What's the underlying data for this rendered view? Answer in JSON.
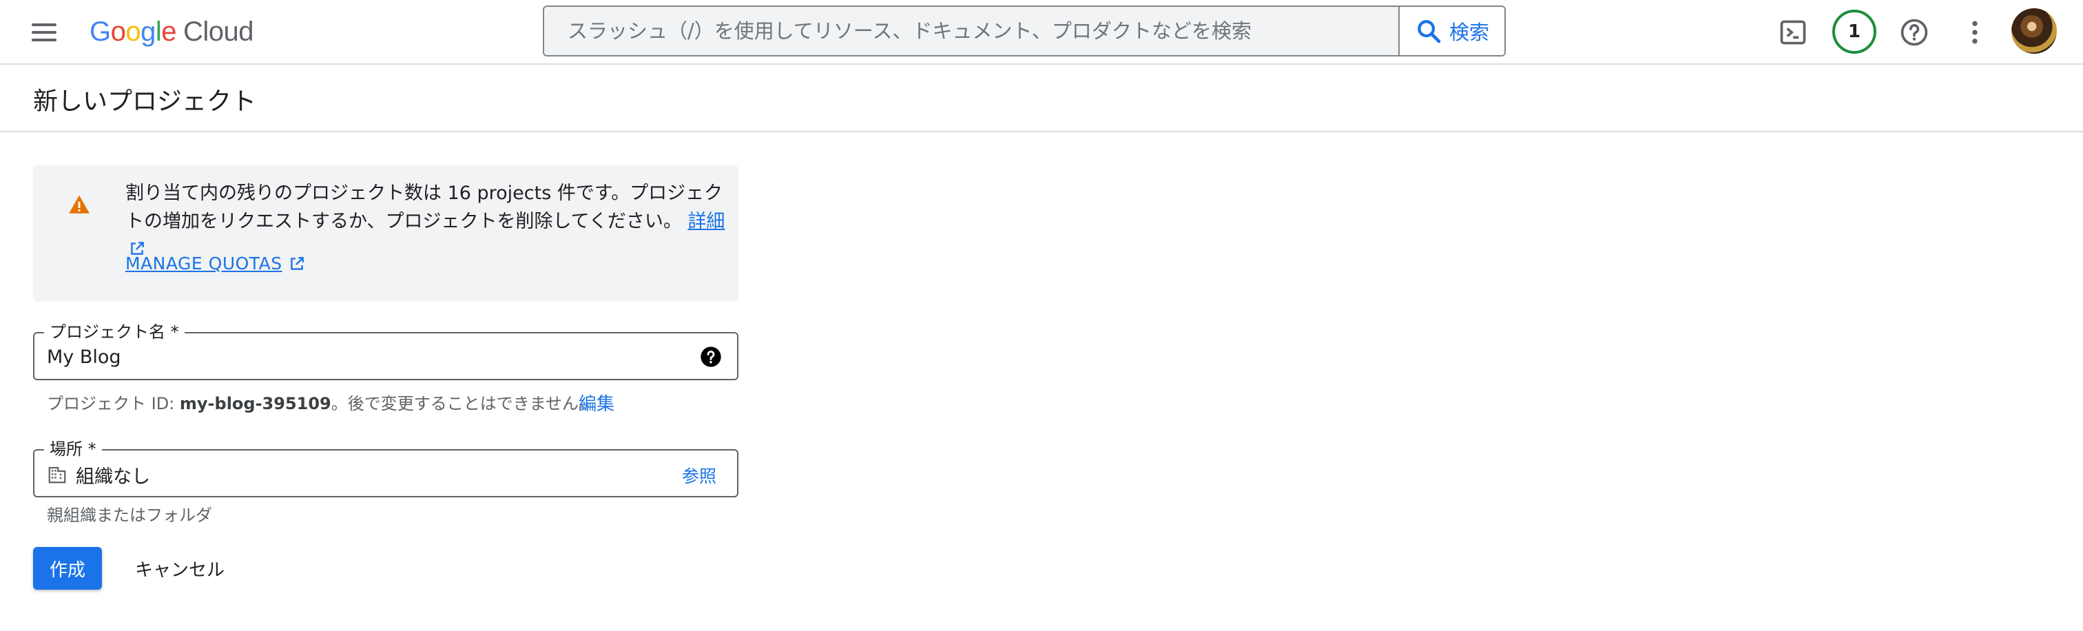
{
  "topbar": {
    "menu_icon": "hamburger-menu-icon",
    "logo": {
      "google_letters": [
        {
          "ch": "G",
          "color": "#4285F4"
        },
        {
          "ch": "o",
          "color": "#EA4335"
        },
        {
          "ch": "o",
          "color": "#FBBC05"
        },
        {
          "ch": "g",
          "color": "#4285F4"
        },
        {
          "ch": "l",
          "color": "#34A853"
        },
        {
          "ch": "e",
          "color": "#EA4335"
        }
      ],
      "cloud_text": "Cloud"
    },
    "search": {
      "placeholder": "スラッシュ（/）を使用してリソース、ドキュメント、プロダクトなどを検索",
      "button_label": "検索"
    },
    "notification_count": "1",
    "icons": [
      "cloud-shell-icon",
      "help-icon",
      "more-vert-icon"
    ]
  },
  "page": {
    "title": "新しいプロジェクト"
  },
  "alert": {
    "text": "割り当て内の残りのプロジェクト数は 16 projects 件です。プロジェクトの増加をリクエストするか、プロジェクトを削除してください。",
    "details_link": "詳細",
    "manage_quotas": "MANAGE QUOTAS",
    "icon": "warning-icon",
    "icon_color": "#E37400"
  },
  "form": {
    "project_name": {
      "label": "プロジェクト名 *",
      "value": "My Blog"
    },
    "project_id_hint": {
      "prefix": "プロジェクト ID: ",
      "id": "my-blog-395109",
      "suffix": "。後で変更することはできません。",
      "edit_link": "編集"
    },
    "location": {
      "label": "場所 *",
      "value": "組織なし",
      "browse_link": "参照",
      "hint": "親組織またはフォルダ"
    },
    "create_button": "作成",
    "cancel_button": "キャンセル"
  },
  "colors": {
    "accent": "#1a73e8",
    "notification_ring": "#1e8e3e",
    "alert_bg": "#f1f3f4"
  }
}
